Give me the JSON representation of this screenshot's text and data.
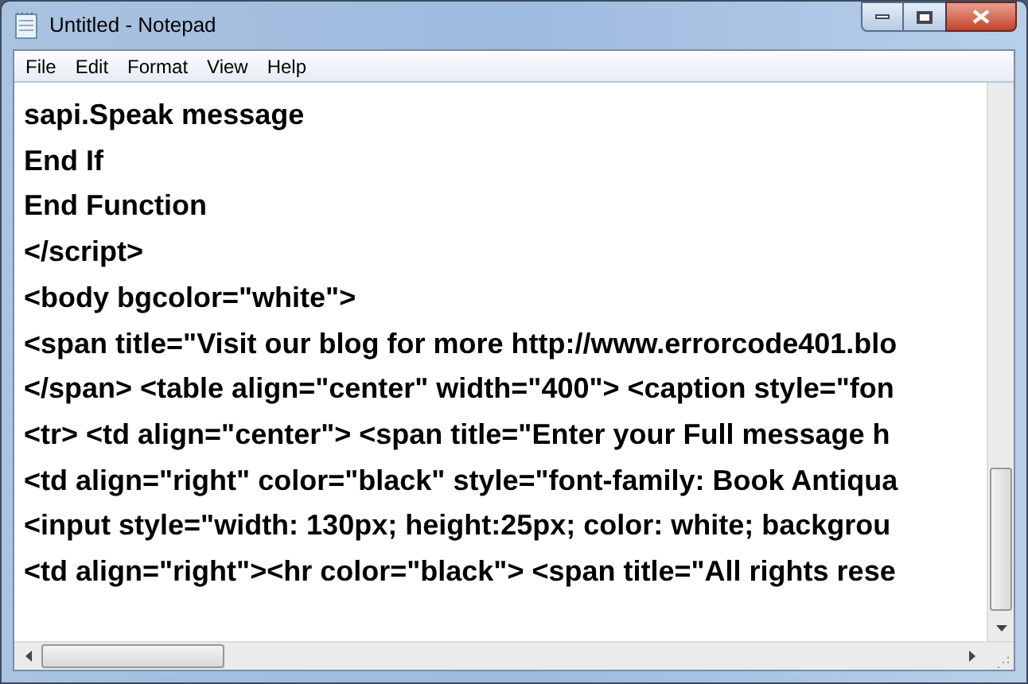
{
  "window": {
    "title": "Untitled - Notepad"
  },
  "menu": [
    "File",
    "Edit",
    "Format",
    "View",
    "Help"
  ],
  "lines": [
    "sapi.Speak message",
    "End If",
    "End Function",
    "</script>",
    "<body bgcolor=\"white\">",
    "<span title=\"Visit our blog for more http://www.errorcode401.blo",
    "</span> <table align=\"center\" width=\"400\"> <caption style=\"fon",
    "<tr> <td align=\"center\"> <span title=\"Enter your Full message h",
    "<td align=\"right\" color=\"black\" style=\"font-family: Book Antiqua",
    "<input style=\"width: 130px; height:25px; color: white; backgrou",
    "<td align=\"right\"><hr color=\"black\"> <span title=\"All rights rese"
  ]
}
